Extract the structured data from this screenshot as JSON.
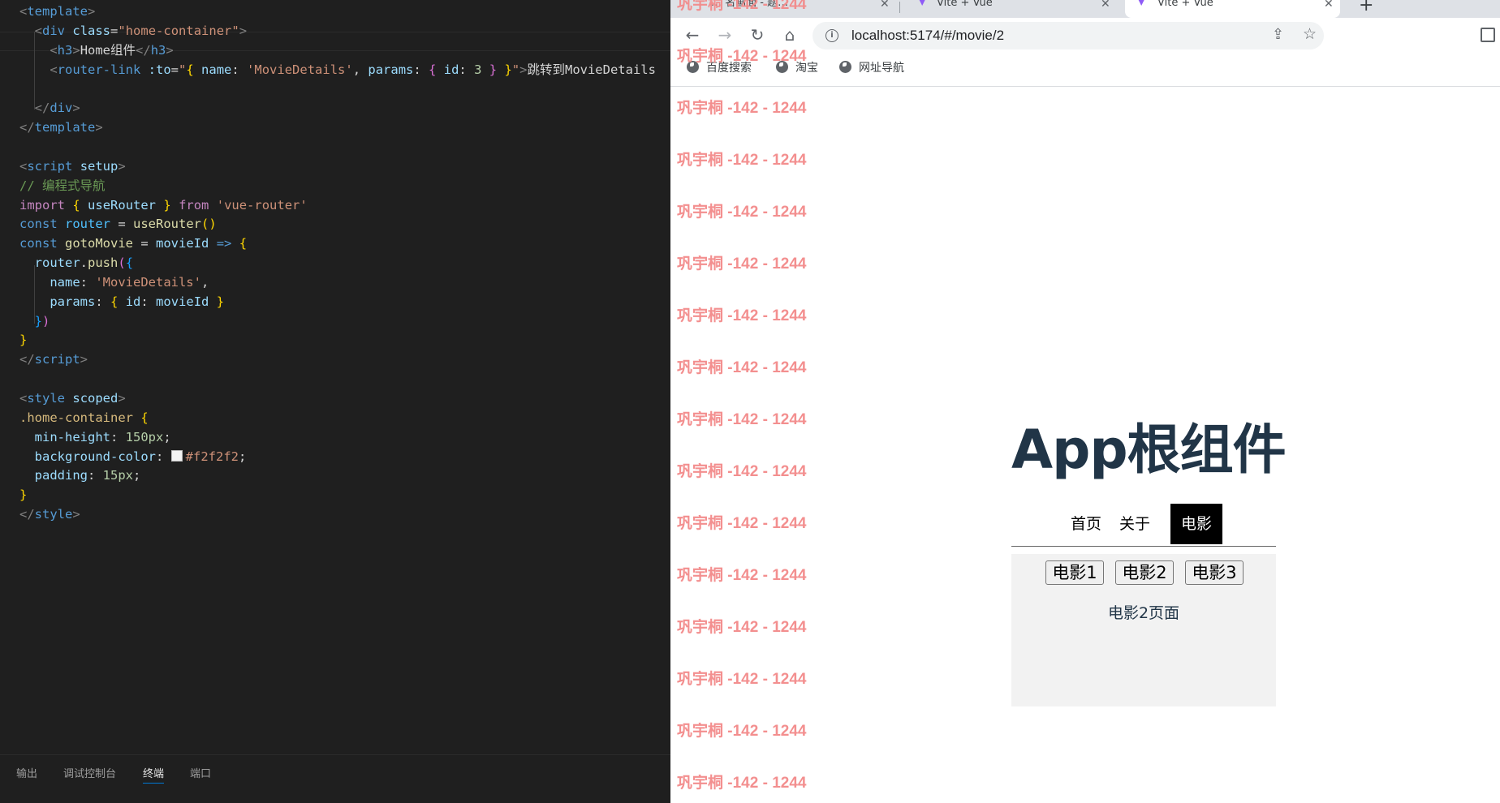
{
  "editor": {
    "code_lines": [
      {
        "html": "<span class='tg'>&lt;</span><span class='tn'>template</span><span class='tg'>&gt;</span>"
      },
      {
        "html": "  <span class='tg'>&lt;</span><span class='tn'>div</span> <span class='at'>class</span>=<span class='st'>\"home-container\"</span><span class='tg'>&gt;</span>"
      },
      {
        "html": "    <span class='tg'>&lt;</span><span class='tn'>h3</span><span class='tg'>&gt;</span><span class='tx'>Home组件</span><span class='tg'>&lt;/</span><span class='tn'>h3</span><span class='tg'>&gt;</span>"
      },
      {
        "html": "    <span class='tg'>&lt;</span><span class='tn'>router-link</span> <span class='at'>:to</span>=<span class='st'>\"</span><span class='b1'>{</span> <span class='vr'>name</span>: <span class='st'>'MovieDetails'</span>, <span class='vr'>params</span>: <span class='b2'>{</span> <span class='vr'>id</span>: <span class='nm'>3</span> <span class='b2'>}</span> <span class='b1'>}</span><span class='st'>\"</span><span class='tg'>&gt;</span><span class='tx'>跳转到MovieDetails</span>"
      },
      {
        "html": ""
      },
      {
        "html": "  <span class='tg'>&lt;/</span><span class='tn'>div</span><span class='tg'>&gt;</span>"
      },
      {
        "html": "<span class='tg'>&lt;/</span><span class='tn'>template</span><span class='tg'>&gt;</span>"
      },
      {
        "html": ""
      },
      {
        "html": "<span class='tg'>&lt;</span><span class='tn'>script</span> <span class='at'>setup</span><span class='tg'>&gt;</span>"
      },
      {
        "html": "<span class='cm'>// 编程式导航</span>"
      },
      {
        "html": "<span class='im'>import</span> <span class='b1'>{</span> <span class='vr'>useRouter</span> <span class='b1'>}</span> <span class='im'>from</span> <span class='st'>'vue-router'</span>"
      },
      {
        "html": "<span class='kw'>const</span> <span class='cn'>router</span> = <span class='fn'>useRouter</span><span class='b1'>()</span>"
      },
      {
        "html": "<span class='kw'>const</span> <span class='fn'>gotoMovie</span> = <span class='vr'>movieId</span> <span class='kw'>=&gt;</span> <span class='b1'>{</span>"
      },
      {
        "html": "  <span class='vr'>router</span>.<span class='fn'>push</span><span class='b2'>(</span><span class='b3'>{</span>"
      },
      {
        "html": "    <span class='vr'>name</span>: <span class='st'>'MovieDetails'</span>,"
      },
      {
        "html": "    <span class='vr'>params</span>: <span class='b1'>{</span> <span class='vr'>id</span>: <span class='vr'>movieId</span> <span class='b1'>}</span>"
      },
      {
        "html": "  <span class='b3'>}</span><span class='b2'>)</span>"
      },
      {
        "html": "<span class='b1'>}</span>"
      },
      {
        "html": "<span class='tg'>&lt;/</span><span class='tn'>script</span><span class='tg'>&gt;</span>"
      },
      {
        "html": ""
      },
      {
        "html": "<span class='tg'>&lt;</span><span class='tn'>style</span> <span class='at'>scoped</span><span class='tg'>&gt;</span>"
      },
      {
        "html": "<span class='sel'>.home-container</span> <span class='b1'>{</span>"
      },
      {
        "html": "  <span class='at'>min-height</span>: <span class='nm'>150px</span>;"
      },
      {
        "html": "  <span class='at'>background-color</span>: <span class='swatch'></span><span class='st'>#f2f2f2</span>;"
      },
      {
        "html": "  <span class='at'>padding</span>: <span class='nm'>15px</span>;"
      },
      {
        "html": "<span class='b1'>}</span>"
      },
      {
        "html": "<span class='tg'>&lt;/</span><span class='tn'>style</span><span class='tg'>&gt;</span>"
      }
    ]
  },
  "panel": {
    "tabs": [
      {
        "label": "输出",
        "active": false
      },
      {
        "label": "调试控制台",
        "active": false
      },
      {
        "label": "终端",
        "active": true
      },
      {
        "label": "端口",
        "active": false
      }
    ]
  },
  "browser": {
    "tabs": [
      {
        "label": "… 名画面 - 题…",
        "active": false
      },
      {
        "label": "Vite + Vue",
        "active": false
      },
      {
        "label": "Vite + Vue",
        "active": true
      }
    ],
    "new_tab": "+",
    "url": "localhost:5174/#/movie/2",
    "bookmarks": [
      "百度搜索",
      "淘宝",
      "网址导航"
    ]
  },
  "watermark": "巩宇桐 -142 - 1244",
  "app": {
    "title": "App根组件",
    "nav": [
      {
        "label": "首页",
        "active": false
      },
      {
        "label": "关于",
        "active": false
      },
      {
        "label": "电影",
        "active": true
      }
    ],
    "movie_buttons": [
      "电影1",
      "电影2",
      "电影3"
    ],
    "movie_text": "电影2页面"
  }
}
